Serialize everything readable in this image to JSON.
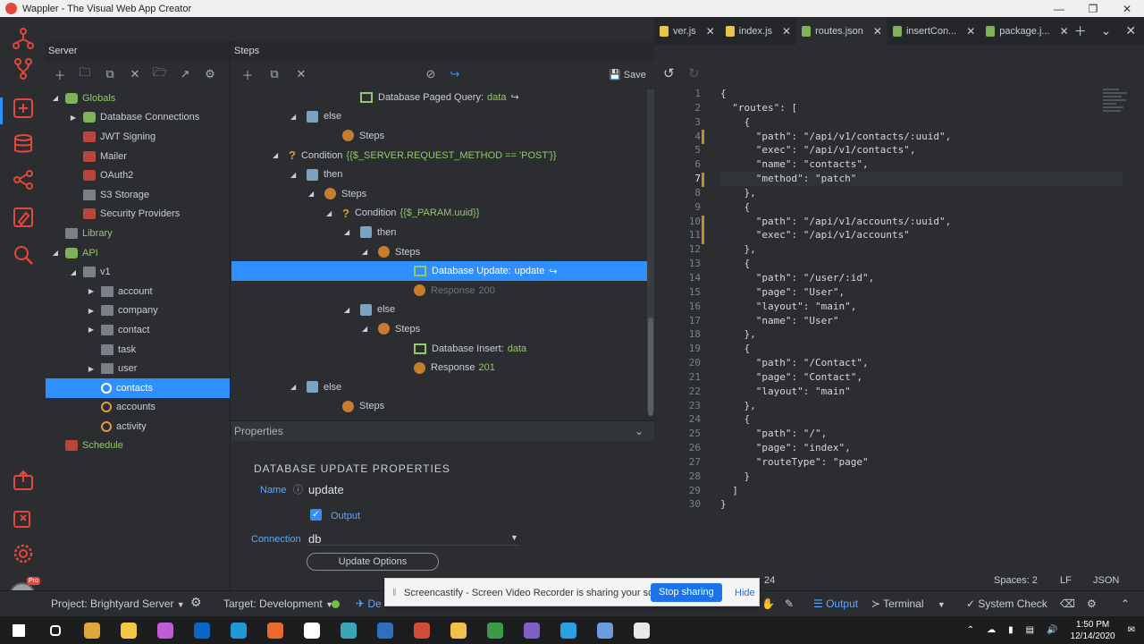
{
  "window": {
    "title": "Wappler - The Visual Web App Creator"
  },
  "server_panel": {
    "header": "Server",
    "toolbar": [
      "add",
      "folder",
      "copy",
      "delete",
      "open",
      "export",
      "settings"
    ],
    "tree": [
      {
        "label": "Globals",
        "level": 0,
        "caret": "open",
        "icon": "globe-icon",
        "style": "green"
      },
      {
        "label": "Database Connections",
        "level": 1,
        "caret": "closed",
        "icon": "database-icon",
        "style": "normal"
      },
      {
        "label": "JWT Signing",
        "level": 1,
        "caret": "",
        "icon": "lock-icon",
        "style": "normal"
      },
      {
        "label": "Mailer",
        "level": 1,
        "caret": "",
        "icon": "lock-icon",
        "style": "normal"
      },
      {
        "label": "OAuth2",
        "level": 1,
        "caret": "",
        "icon": "lock-icon",
        "style": "normal"
      },
      {
        "label": "S3 Storage",
        "level": 1,
        "caret": "",
        "icon": "cloud-icon",
        "style": "normal"
      },
      {
        "label": "Security Providers",
        "level": 1,
        "caret": "",
        "icon": "users-icon",
        "style": "normal"
      },
      {
        "label": "Library",
        "level": 0,
        "caret": "",
        "icon": "folder-icon",
        "style": "green"
      },
      {
        "label": "API",
        "level": 0,
        "caret": "open",
        "icon": "api-icon",
        "style": "green"
      },
      {
        "label": "v1",
        "level": 1,
        "caret": "open",
        "icon": "folder-icon",
        "style": "normal"
      },
      {
        "label": "account",
        "level": 2,
        "caret": "closed",
        "icon": "folder-icon",
        "style": "normal"
      },
      {
        "label": "company",
        "level": 2,
        "caret": "closed",
        "icon": "folder-icon",
        "style": "normal"
      },
      {
        "label": "contact",
        "level": 2,
        "caret": "closed",
        "icon": "folder-icon",
        "style": "normal"
      },
      {
        "label": "task",
        "level": 2,
        "caret": "",
        "icon": "folder-icon",
        "style": "normal"
      },
      {
        "label": "user",
        "level": 2,
        "caret": "closed",
        "icon": "folder-icon",
        "style": "normal"
      },
      {
        "label": "contacts",
        "level": 2,
        "caret": "",
        "icon": "action-icon",
        "style": "selected"
      },
      {
        "label": "accounts",
        "level": 2,
        "caret": "",
        "icon": "action-icon",
        "style": "normal"
      },
      {
        "label": "activity",
        "level": 2,
        "caret": "",
        "icon": "action-icon",
        "style": "normal"
      },
      {
        "label": "Schedule",
        "level": 0,
        "caret": "",
        "icon": "schedule-icon",
        "style": "green"
      }
    ]
  },
  "steps_panel": {
    "header": "Steps",
    "save_label": "Save",
    "rows": [
      {
        "indent": 126,
        "caret": "",
        "icon": "table",
        "label": "Database Paged Query:",
        "value": "data",
        "suffix": "↪",
        "style": "normal"
      },
      {
        "indent": 66,
        "caret": "open",
        "icon": "cube",
        "label": "else",
        "value": "",
        "suffix": "",
        "style": "normal"
      },
      {
        "indent": 106,
        "caret": "",
        "icon": "step",
        "label": "Steps",
        "value": "",
        "suffix": "",
        "style": "normal"
      },
      {
        "indent": 46,
        "caret": "open",
        "icon": "question",
        "label": "Condition",
        "value": "{{$_SERVER.REQUEST_METHOD == 'POST'}}",
        "suffix": "",
        "style": "normal"
      },
      {
        "indent": 66,
        "caret": "open",
        "icon": "cube",
        "label": "then",
        "value": "",
        "suffix": "",
        "style": "normal"
      },
      {
        "indent": 86,
        "caret": "open",
        "icon": "step",
        "label": "Steps",
        "value": "",
        "suffix": "",
        "style": "normal"
      },
      {
        "indent": 106,
        "caret": "open",
        "icon": "question",
        "label": "Condition",
        "value": "{{$_PARAM.uuid}}",
        "suffix": "",
        "style": "normal"
      },
      {
        "indent": 126,
        "caret": "open",
        "icon": "cube",
        "label": "then",
        "value": "",
        "suffix": "",
        "style": "normal"
      },
      {
        "indent": 146,
        "caret": "open",
        "icon": "step",
        "label": "Steps",
        "value": "",
        "suffix": "",
        "style": "normal"
      },
      {
        "indent": 186,
        "caret": "",
        "icon": "table",
        "label": "Database Update:",
        "value": "update",
        "suffix": "↪",
        "style": "selected"
      },
      {
        "indent": 186,
        "caret": "",
        "icon": "step",
        "label": "Response",
        "value": "200",
        "suffix": "",
        "style": "muted"
      },
      {
        "indent": 126,
        "caret": "open",
        "icon": "cube",
        "label": "else",
        "value": "",
        "suffix": "",
        "style": "normal"
      },
      {
        "indent": 146,
        "caret": "open",
        "icon": "step",
        "label": "Steps",
        "value": "",
        "suffix": "",
        "style": "normal"
      },
      {
        "indent": 186,
        "caret": "",
        "icon": "table",
        "label": "Database Insert:",
        "value": "data",
        "suffix": "",
        "style": "normal"
      },
      {
        "indent": 186,
        "caret": "",
        "icon": "step",
        "label": "Response",
        "value": "201",
        "suffix": "",
        "style": "normal"
      },
      {
        "indent": 66,
        "caret": "open",
        "icon": "cube",
        "label": "else",
        "value": "",
        "suffix": "",
        "style": "normal"
      },
      {
        "indent": 106,
        "caret": "",
        "icon": "step",
        "label": "Steps",
        "value": "",
        "suffix": "",
        "style": "normal"
      }
    ]
  },
  "properties": {
    "header": "Properties",
    "title": "DATABASE UPDATE PROPERTIES",
    "name_label": "Name",
    "name_value": "update",
    "output_label": "Output",
    "connection_label": "Connection",
    "connection_value": "db",
    "update_options_label": "Update Options"
  },
  "editor": {
    "tabs": [
      {
        "label": "ver.js",
        "icon_color": "#e8c447",
        "active": false
      },
      {
        "label": "index.js",
        "icon_color": "#e8c447",
        "active": false
      },
      {
        "label": "routes.json",
        "icon_color": "#7fb35a",
        "active": true
      },
      {
        "label": "insertCon...",
        "icon_color": "#7fb35a",
        "active": false
      },
      {
        "label": "package.j...",
        "icon_color": "#7fb35a",
        "active": false
      }
    ],
    "current_line": 7,
    "lines": [
      "{",
      "  \"routes\": [",
      "    {",
      "      \"path\": \"/api/v1/contacts/:uuid\",",
      "      \"exec\": \"/api/v1/contacts\",",
      "      \"name\": \"contacts\",",
      "      \"method\": \"patch\"",
      "    },",
      "    {",
      "      \"path\": \"/api/v1/accounts/:uuid\",",
      "      \"exec\": \"/api/v1/accounts\"",
      "    },",
      "    {",
      "      \"path\": \"/user/:id\",",
      "      \"page\": \"User\",",
      "      \"layout\": \"main\",",
      "      \"name\": \"User\"",
      "    },",
      "    {",
      "      \"path\": \"/Contact\",",
      "      \"page\": \"Contact\",",
      "      \"layout\": \"main\"",
      "    },",
      "    {",
      "      \"path\": \"/\",",
      "      \"page\": \"index\",",
      "      \"routeType\": \"page\"",
      "    }",
      "  ]",
      "}"
    ],
    "status": {
      "col": "24",
      "spaces": "Spaces: 2",
      "eol": "LF",
      "lang": "JSON"
    }
  },
  "statusbar": {
    "project_label": "Project:",
    "project_value": "Brightyard Server",
    "target_label": "Target:",
    "target_value": "Development",
    "deploy_label": "De",
    "output_label": "Output",
    "terminal_label": "Terminal",
    "system_check_label": "System Check"
  },
  "share_bar": {
    "message": "Screencastify - Screen Video Recorder is sharing your screen.",
    "stop_label": "Stop sharing",
    "hide_label": "Hide"
  },
  "taskbar": {
    "apps": [
      "windows-start",
      "task-view",
      "chrome",
      "file-explorer",
      "app",
      "outlook",
      "edge",
      "wappler",
      "notepad",
      "app2",
      "app3",
      "app4",
      "app5",
      "app6",
      "app7",
      "app8",
      "app9",
      "calculator"
    ],
    "app_colors": [
      "#ffffff",
      "#ffffff",
      "#e0a53b",
      "#f2c744",
      "#c05bd6",
      "#0a67c5",
      "#1f9ad6",
      "#ea6a2b",
      "#ffffff",
      "#3aa6b9",
      "#2f6fbf",
      "#d24c3c",
      "#f0c24a",
      "#3d9a47",
      "#7f5fc5",
      "#2aa0e0",
      "#6a9de0",
      "#e8e8e8"
    ],
    "time": "1:50 PM",
    "date": "12/14/2020"
  }
}
